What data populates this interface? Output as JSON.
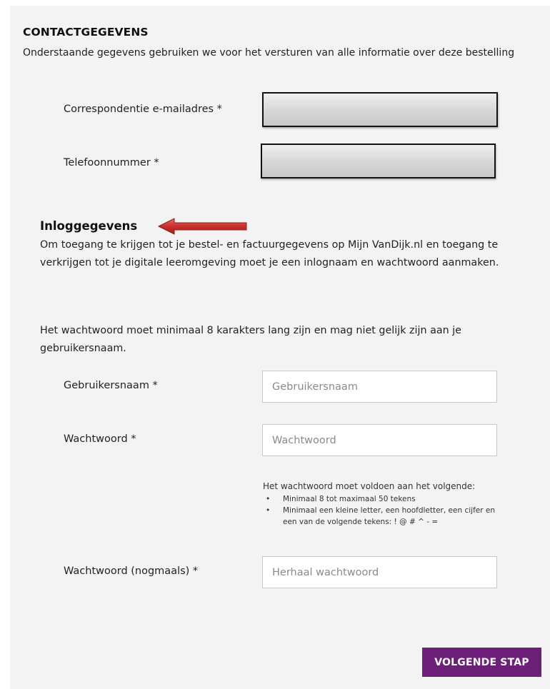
{
  "contact": {
    "heading": "CONTACTGEGEVENS",
    "intro": "Onderstaande gegevens gebruiken we voor het versturen van alle informatie over deze bestelling",
    "email_label": "Correspondentie e-mailadres *",
    "phone_label": "Telefoonnummer *"
  },
  "login": {
    "heading": "Inloggegevens",
    "intro": "Om toegang te krijgen tot je bestel- en factuurgegevens op Mijn VanDijk.nl en toegang te verkrijgen tot je digitale leeromgeving moet je een inlognaam en wachtwoord aanmaken.",
    "password_note": "Het wachtwoord moet minimaal 8 karakters lang zijn en mag niet gelijk zijn aan je gebruikersnaam.",
    "username_label": "Gebruikersnaam *",
    "username_placeholder": "Gebruikersnaam",
    "password_label": "Wachtwoord *",
    "password_placeholder": "Wachtwoord",
    "requirements_title": "Het wachtwoord moet voldoen aan het volgende:",
    "requirements": [
      "Minimaal 8 tot maximaal 50 tekens",
      "Minimaal een kleine letter, een hoofdletter, een cijfer en een van de volgende tekens: ! @ # ^ - ="
    ],
    "repeat_label": "Wachtwoord (nogmaals) *",
    "repeat_placeholder": "Herhaal wachtwoord"
  },
  "annotation": {
    "arrow_color": "#c9302c"
  },
  "next_button": {
    "label": "VOLGENDE STAP",
    "color": "#6d2077"
  }
}
